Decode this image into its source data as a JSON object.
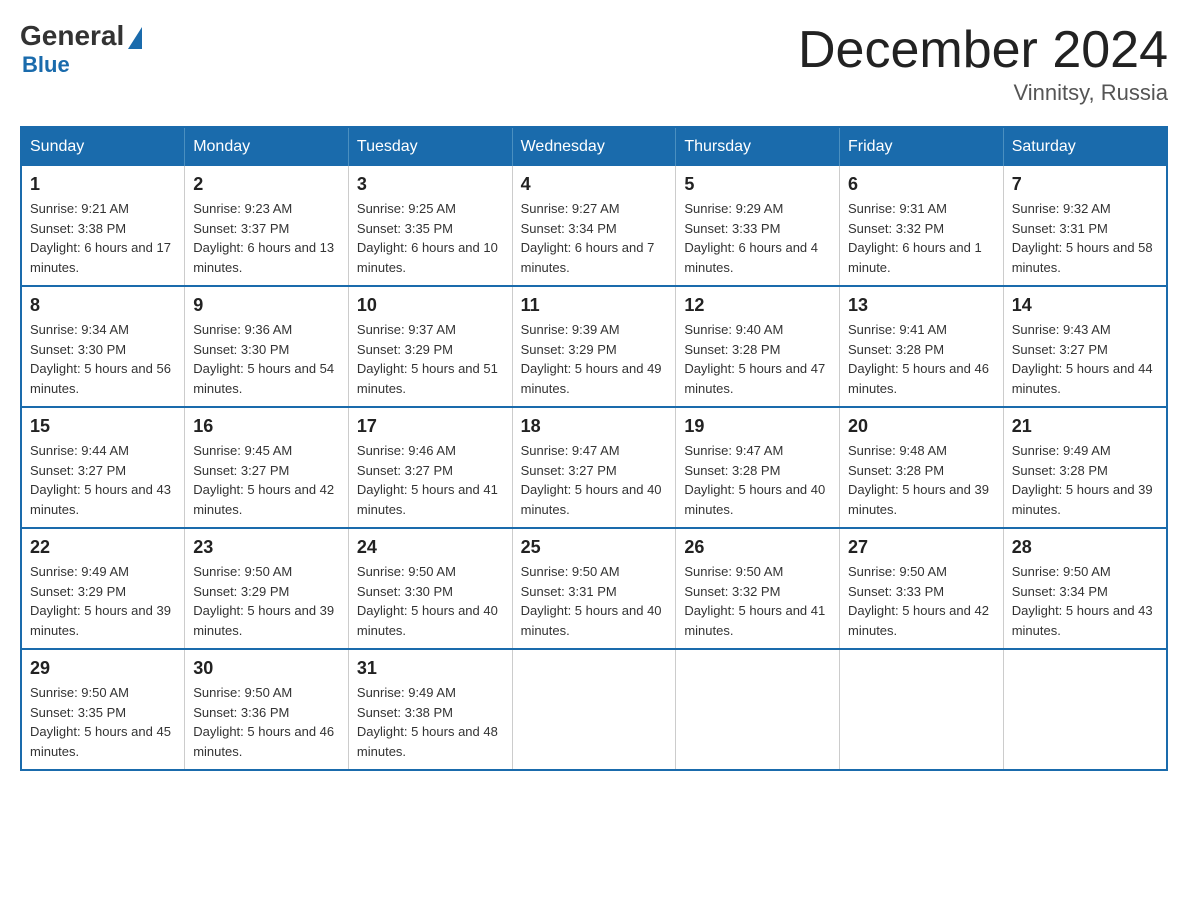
{
  "logo": {
    "general": "General",
    "blue": "Blue"
  },
  "title": "December 2024",
  "location": "Vinnitsy, Russia",
  "days_of_week": [
    "Sunday",
    "Monday",
    "Tuesday",
    "Wednesday",
    "Thursday",
    "Friday",
    "Saturday"
  ],
  "weeks": [
    [
      {
        "day": "1",
        "sunrise": "9:21 AM",
        "sunset": "3:38 PM",
        "daylight": "6 hours and 17 minutes."
      },
      {
        "day": "2",
        "sunrise": "9:23 AM",
        "sunset": "3:37 PM",
        "daylight": "6 hours and 13 minutes."
      },
      {
        "day": "3",
        "sunrise": "9:25 AM",
        "sunset": "3:35 PM",
        "daylight": "6 hours and 10 minutes."
      },
      {
        "day": "4",
        "sunrise": "9:27 AM",
        "sunset": "3:34 PM",
        "daylight": "6 hours and 7 minutes."
      },
      {
        "day": "5",
        "sunrise": "9:29 AM",
        "sunset": "3:33 PM",
        "daylight": "6 hours and 4 minutes."
      },
      {
        "day": "6",
        "sunrise": "9:31 AM",
        "sunset": "3:32 PM",
        "daylight": "6 hours and 1 minute."
      },
      {
        "day": "7",
        "sunrise": "9:32 AM",
        "sunset": "3:31 PM",
        "daylight": "5 hours and 58 minutes."
      }
    ],
    [
      {
        "day": "8",
        "sunrise": "9:34 AM",
        "sunset": "3:30 PM",
        "daylight": "5 hours and 56 minutes."
      },
      {
        "day": "9",
        "sunrise": "9:36 AM",
        "sunset": "3:30 PM",
        "daylight": "5 hours and 54 minutes."
      },
      {
        "day": "10",
        "sunrise": "9:37 AM",
        "sunset": "3:29 PM",
        "daylight": "5 hours and 51 minutes."
      },
      {
        "day": "11",
        "sunrise": "9:39 AM",
        "sunset": "3:29 PM",
        "daylight": "5 hours and 49 minutes."
      },
      {
        "day": "12",
        "sunrise": "9:40 AM",
        "sunset": "3:28 PM",
        "daylight": "5 hours and 47 minutes."
      },
      {
        "day": "13",
        "sunrise": "9:41 AM",
        "sunset": "3:28 PM",
        "daylight": "5 hours and 46 minutes."
      },
      {
        "day": "14",
        "sunrise": "9:43 AM",
        "sunset": "3:27 PM",
        "daylight": "5 hours and 44 minutes."
      }
    ],
    [
      {
        "day": "15",
        "sunrise": "9:44 AM",
        "sunset": "3:27 PM",
        "daylight": "5 hours and 43 minutes."
      },
      {
        "day": "16",
        "sunrise": "9:45 AM",
        "sunset": "3:27 PM",
        "daylight": "5 hours and 42 minutes."
      },
      {
        "day": "17",
        "sunrise": "9:46 AM",
        "sunset": "3:27 PM",
        "daylight": "5 hours and 41 minutes."
      },
      {
        "day": "18",
        "sunrise": "9:47 AM",
        "sunset": "3:27 PM",
        "daylight": "5 hours and 40 minutes."
      },
      {
        "day": "19",
        "sunrise": "9:47 AM",
        "sunset": "3:28 PM",
        "daylight": "5 hours and 40 minutes."
      },
      {
        "day": "20",
        "sunrise": "9:48 AM",
        "sunset": "3:28 PM",
        "daylight": "5 hours and 39 minutes."
      },
      {
        "day": "21",
        "sunrise": "9:49 AM",
        "sunset": "3:28 PM",
        "daylight": "5 hours and 39 minutes."
      }
    ],
    [
      {
        "day": "22",
        "sunrise": "9:49 AM",
        "sunset": "3:29 PM",
        "daylight": "5 hours and 39 minutes."
      },
      {
        "day": "23",
        "sunrise": "9:50 AM",
        "sunset": "3:29 PM",
        "daylight": "5 hours and 39 minutes."
      },
      {
        "day": "24",
        "sunrise": "9:50 AM",
        "sunset": "3:30 PM",
        "daylight": "5 hours and 40 minutes."
      },
      {
        "day": "25",
        "sunrise": "9:50 AM",
        "sunset": "3:31 PM",
        "daylight": "5 hours and 40 minutes."
      },
      {
        "day": "26",
        "sunrise": "9:50 AM",
        "sunset": "3:32 PM",
        "daylight": "5 hours and 41 minutes."
      },
      {
        "day": "27",
        "sunrise": "9:50 AM",
        "sunset": "3:33 PM",
        "daylight": "5 hours and 42 minutes."
      },
      {
        "day": "28",
        "sunrise": "9:50 AM",
        "sunset": "3:34 PM",
        "daylight": "5 hours and 43 minutes."
      }
    ],
    [
      {
        "day": "29",
        "sunrise": "9:50 AM",
        "sunset": "3:35 PM",
        "daylight": "5 hours and 45 minutes."
      },
      {
        "day": "30",
        "sunrise": "9:50 AM",
        "sunset": "3:36 PM",
        "daylight": "5 hours and 46 minutes."
      },
      {
        "day": "31",
        "sunrise": "9:49 AM",
        "sunset": "3:38 PM",
        "daylight": "5 hours and 48 minutes."
      },
      null,
      null,
      null,
      null
    ]
  ]
}
